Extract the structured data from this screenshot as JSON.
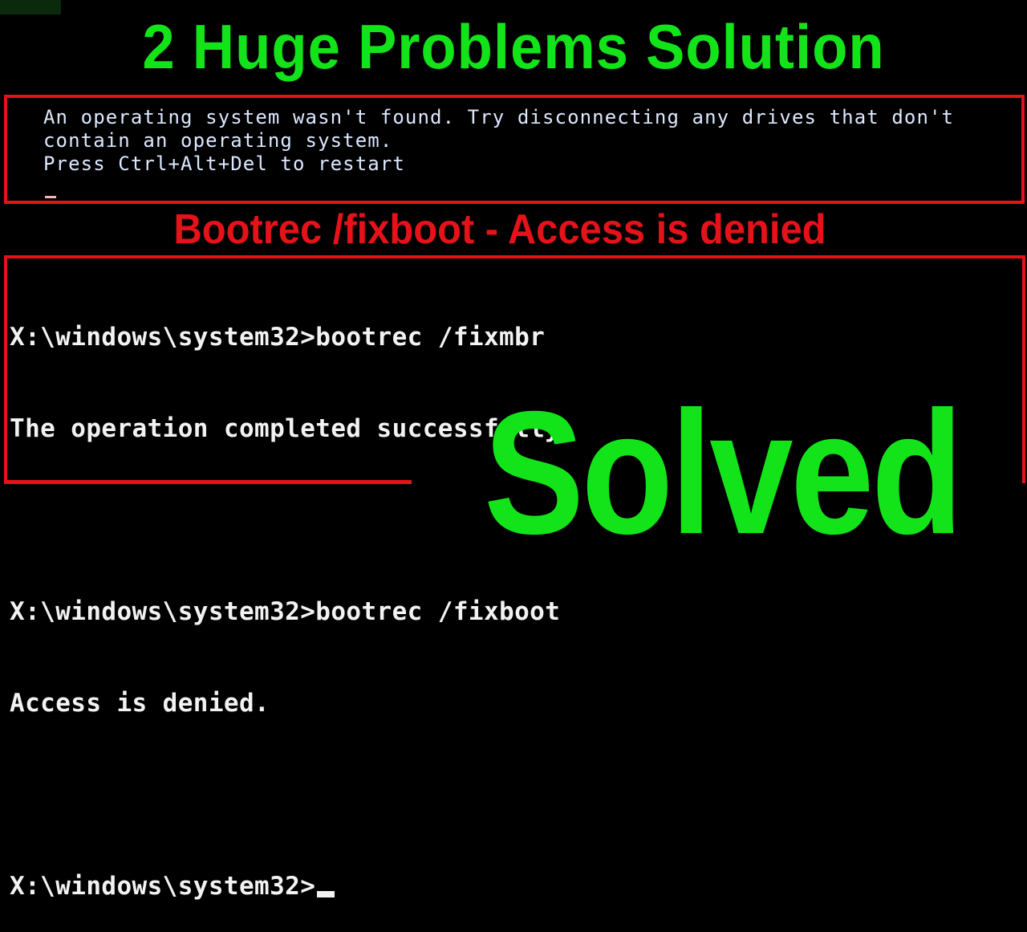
{
  "title": "2 Huge Problems Solution",
  "boot_error": {
    "lines": [
      "An operating system wasn't found. Try disconnecting any drives that don't",
      "contain an operating system.",
      "Press Ctrl+Alt+Del to restart"
    ]
  },
  "subtitle": "Bootrec /fixboot - Access is denied",
  "console": {
    "lines": [
      "X:\\windows\\system32>bootrec /fixmbr",
      "The operation completed successfully.",
      "",
      "X:\\windows\\system32>bootrec /fixboot",
      "Access is denied.",
      "",
      "X:\\windows\\system32>"
    ]
  },
  "badge": "Solved",
  "colors": {
    "green": "#13e41a",
    "red": "#e5121a",
    "boot_text": "#dde8ff",
    "console_text": "#f2f2f2",
    "background": "#000000"
  }
}
